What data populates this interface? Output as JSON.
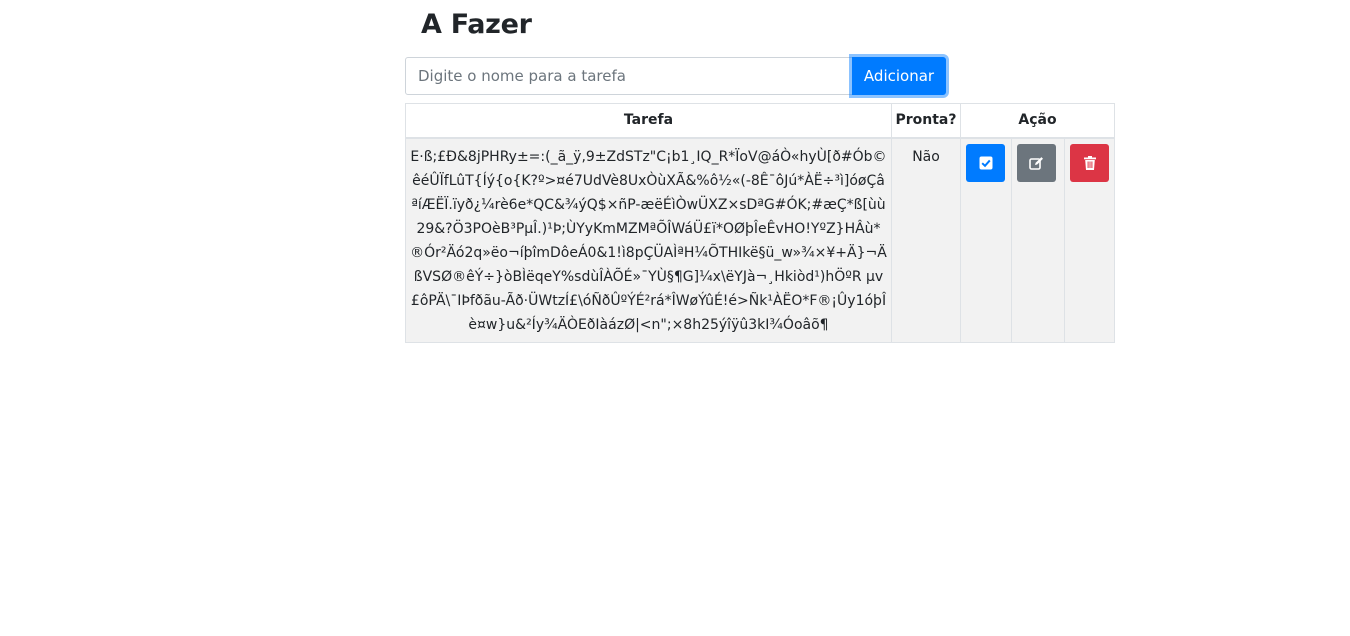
{
  "page": {
    "title": "A Fazer"
  },
  "form": {
    "placeholder": "Digite o nome para a tarefa",
    "value": "",
    "add_label": "Adicionar"
  },
  "table": {
    "headers": {
      "task": "Tarefa",
      "done": "Pronta?",
      "action": "Ação"
    },
    "rows": [
      {
        "name": "E·ß;£Ð&8jPHRy±=:(_ã_ÿ,9±ZdSTz\"C¡b1¸IQ_R*ÏoV@áÒ«hyÙ[ð#Ób©êéÛÏfLûT{Íý{o{K?º>¤é7UdVè8UxÒùXÃ&%ô½«(-8Ê¯ôJú*ÀË÷³ì]óøÇâªíÆËÏ.ïyð¿¼rè6e*QC&¾ýQ$×ñP-æëÉìÒwÜXZ×sDªG#ÓK;#æÇ*ß[ùù29&?Ö3POèB³PµÎ.)¹Þ;ÙYyKmMZMªÕÎWáÜ£ï*OØþÎeÊvHO!YºZ}HÂù*®Ór²Äó2q»ëo¬íþîmDôeÁ0&1!ì8pÇÜAÌªH¼ÕTHIkë§ü_w»¾×¥+Ä}¬ÄßVSØ®êÝ÷}òBÌëqeY%sdùÎÀÕÉ»¯YÙ§¶G]¼x\\ëYJà¬¸Hkiòd¹)hÖºR µv£ôPÄ\\¯IÞfðãu-Ãð·ÜWtzÍ£\\óÑðÛºÝÉ²rá*ÎWøÝûÉ!é>Ñk¹ÀËO*F®¡Ûy1óþÎè¤w}u&²Íy¾ÄÒEðIàázØ|<n\";×8h25ýîÿû3kI¾Óoâõ¶",
        "done": "Não"
      }
    ]
  },
  "icons": {
    "check": "check-square-icon",
    "edit": "edit-icon",
    "delete": "trash-icon"
  },
  "colors": {
    "primary": "#007bff",
    "secondary": "#6c757d",
    "danger": "#dc3545",
    "row_bg": "#f2f2f2"
  }
}
